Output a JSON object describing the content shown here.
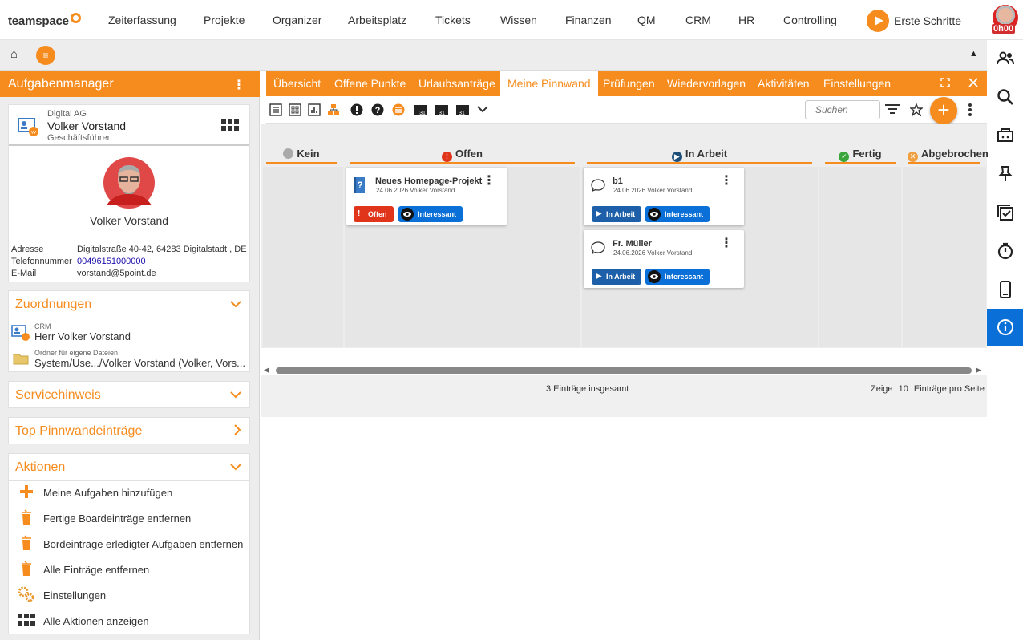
{
  "brand": {
    "logo": "teamspace"
  },
  "topnav": {
    "items": [
      "Zeiterfassung",
      "Projekte",
      "Organizer",
      "Arbeitsplatz",
      "Tickets",
      "Wissen",
      "Finanzen",
      "QM",
      "CRM",
      "HR",
      "Controlling"
    ],
    "erste_schritte": "Erste Schritte",
    "timer": "0h00"
  },
  "left": {
    "title": "Aufgabenmanager",
    "profile": {
      "company": "Digital AG",
      "name": "Volker Vorstand",
      "role": "Geschäftsführer",
      "display_name": "Volker Vorstand",
      "address_label": "Adresse",
      "address": "Digitalstraße 40-42, 64283 Digitalstadt , DE",
      "phone_label": "Telefonnummer",
      "phone": "00496151000000",
      "email_label": "E-Mail",
      "email": "vorstand@5point.de"
    },
    "zuordnungen": {
      "title": "Zuordnungen",
      "crm_label": "CRM",
      "crm_value": "Herr Volker Vorstand",
      "folder_label": "Ordner für eigene Dateien",
      "folder_value": "System/Use.../Volker Vorstand (Volker, Vors..."
    },
    "servicehinweis": "Servicehinweis",
    "top_pinnwand": "Top Pinnwandeinträge",
    "aktionen": {
      "title": "Aktionen",
      "items": [
        "Meine Aufgaben hinzufügen",
        "Fertige Boardeinträge entfernen",
        "Bordeinträge erledigter Aufgaben entfernen",
        "Alle Einträge entfernen",
        "Einstellungen",
        "Alle Aktionen anzeigen"
      ]
    }
  },
  "tabs": [
    "Übersicht",
    "Offene Punkte",
    "Urlaubsanträge",
    "Meine Pinnwand",
    "Prüfungen",
    "Wiedervorlagen",
    "Aktivitäten",
    "Einstellungen"
  ],
  "active_tab": "Meine Pinnwand",
  "toolbar": {
    "search_placeholder": "Suchen"
  },
  "columns": [
    "Kein",
    "Offen",
    "In Arbeit",
    "Fertig",
    "Abgebrochen"
  ],
  "cards": [
    {
      "title": "Neues Homepage-Projekt",
      "meta": "24.06.2026 Volker Vorstand",
      "status": "Offen",
      "tag": "Interessant"
    },
    {
      "title": "b1",
      "meta": "24.06.2026 Volker Vorstand",
      "status": "In Arbeit",
      "tag": "Interessant"
    },
    {
      "title": "Fr. Müller",
      "meta": "24.06.2026 Volker Vorstand",
      "status": "In Arbeit",
      "tag": "Interessant"
    }
  ],
  "footer": {
    "total": "3 Einträge insgesamt",
    "show_label": "Zeige",
    "per_page": "10",
    "per_page_suffix": "Einträge pro Seite"
  },
  "colors": {
    "accent": "#f68c1e",
    "active_blue": "#0a6fd6",
    "status_red": "#e0341b"
  }
}
